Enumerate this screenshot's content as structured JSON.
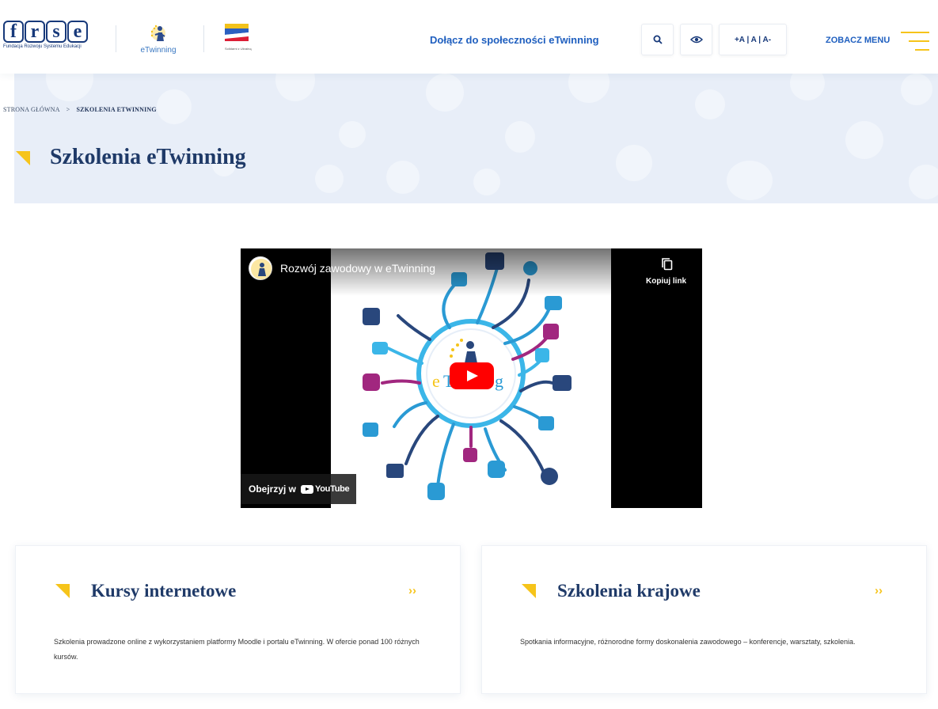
{
  "header": {
    "frse_letters": [
      "f",
      "r",
      "s",
      "e"
    ],
    "frse_subtitle": "Fundacja Rozwoju Systemu Edukacji",
    "etwinning_label": "eTwinning",
    "ukraine_text": "Solidarni z Ukrainą",
    "join_link": "Dołącz do społeczności eTwinning",
    "font_size_controls": "+A | A | A-",
    "menu_label": "ZOBACZ MENU"
  },
  "breadcrumb": {
    "home": "STRONA GŁÓWNA",
    "separator": ">",
    "current": "SZKOLENIA ETWINNING"
  },
  "page_title": "Szkolenia eTwinning",
  "video": {
    "title": "Rozwój zawodowy w eTwinning",
    "copy_link": "Kopiuj link",
    "watch_on": "Obejrzyj w",
    "youtube": "YouTube",
    "logo_e": "e",
    "logo_t": "T",
    "logo_g": "g"
  },
  "cards": [
    {
      "title": "Kursy internetowe",
      "arrow": "››",
      "text": "Szkolenia prowadzone online z wykorzystaniem platformy Moodle i portalu eTwinning. W ofercie ponad 100 różnych kursów."
    },
    {
      "title": "Szkolenia krajowe",
      "arrow": "››",
      "text": "Spotkania informacyjne, różnorodne formy doskonalenia zawodowego – konferencje, warsztaty, szkolenia."
    }
  ],
  "colors": {
    "accent_yellow": "#f6c41a",
    "navy": "#1f3a68",
    "link_blue": "#1f5fbf",
    "hero_bg": "#e8eef8"
  }
}
